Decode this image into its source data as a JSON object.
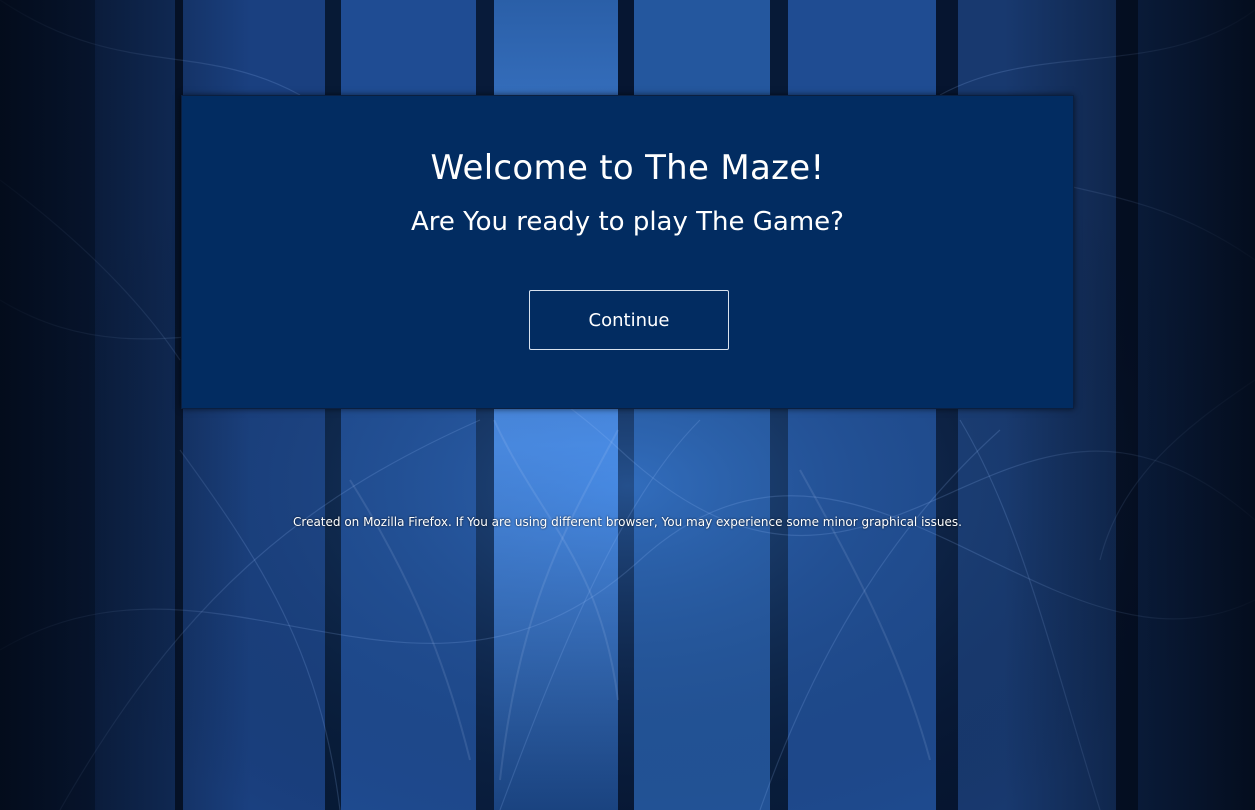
{
  "welcome": {
    "title": "Welcome to The Maze!",
    "subtitle": "Are You ready to play The Game?",
    "continue_label": "Continue"
  },
  "footer": {
    "note": "Created on Mozilla Firefox. If You are using different browser, You may experience some minor graphical issues."
  },
  "colors": {
    "panel_background": "#022c61",
    "page_background": "#07152c",
    "text": "#ffffff",
    "accent_glow": "#5aa0ff"
  }
}
